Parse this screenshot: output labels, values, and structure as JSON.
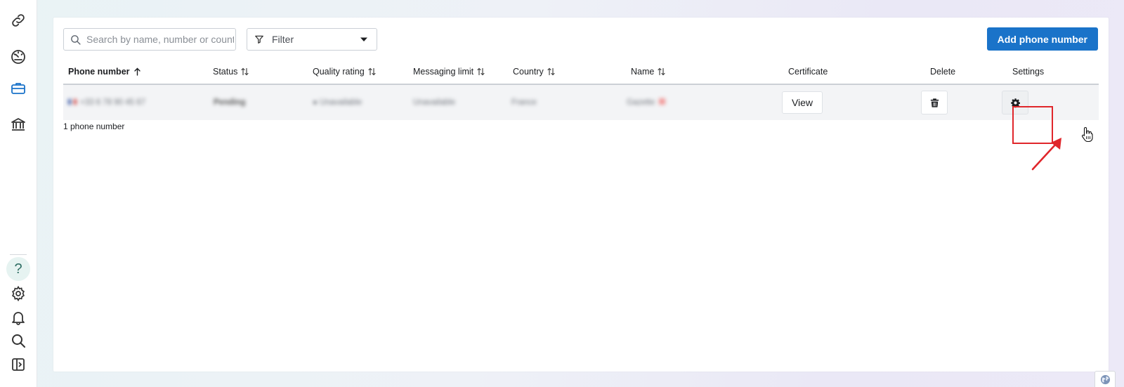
{
  "rail": {
    "top_icons": [
      "link-icon",
      "dashboard-gauge-icon",
      "briefcase-icon",
      "bank-icon"
    ],
    "bottom_icons": [
      "help-icon",
      "gear-icon",
      "bell-icon",
      "search-icon",
      "sidebar-toggle-icon"
    ],
    "help_label": "?",
    "active_color": "#1a73c9"
  },
  "toolbar": {
    "search_placeholder": "Search by name, number or country",
    "filter_label": "Filter",
    "add_button_label": "Add phone number"
  },
  "table": {
    "columns": [
      {
        "label": "Phone number",
        "sort": "ascending"
      },
      {
        "label": "Status",
        "sort": "sortable"
      },
      {
        "label": "Quality rating",
        "sort": "sortable"
      },
      {
        "label": "Messaging limit",
        "sort": "sortable"
      },
      {
        "label": "Country",
        "sort": "sortable"
      },
      {
        "label": "Name",
        "sort": "sortable"
      },
      {
        "label": "Certificate",
        "sort": "none"
      },
      {
        "label": "Delete",
        "sort": "none"
      },
      {
        "label": "Settings",
        "sort": "none"
      }
    ],
    "rows": [
      {
        "phone": "+33 6 78 90 45 67",
        "status": "Pending",
        "quality_rating": "Unavailable",
        "messaging_limit": "Unavailable",
        "country": "France",
        "name": "Gazette",
        "certificate_button": "View"
      }
    ],
    "count_label": "1 phone number"
  },
  "colors": {
    "primary_button": "#1a73c9",
    "highlight_box": "#e0262b",
    "row_background": "#f3f4f6"
  }
}
